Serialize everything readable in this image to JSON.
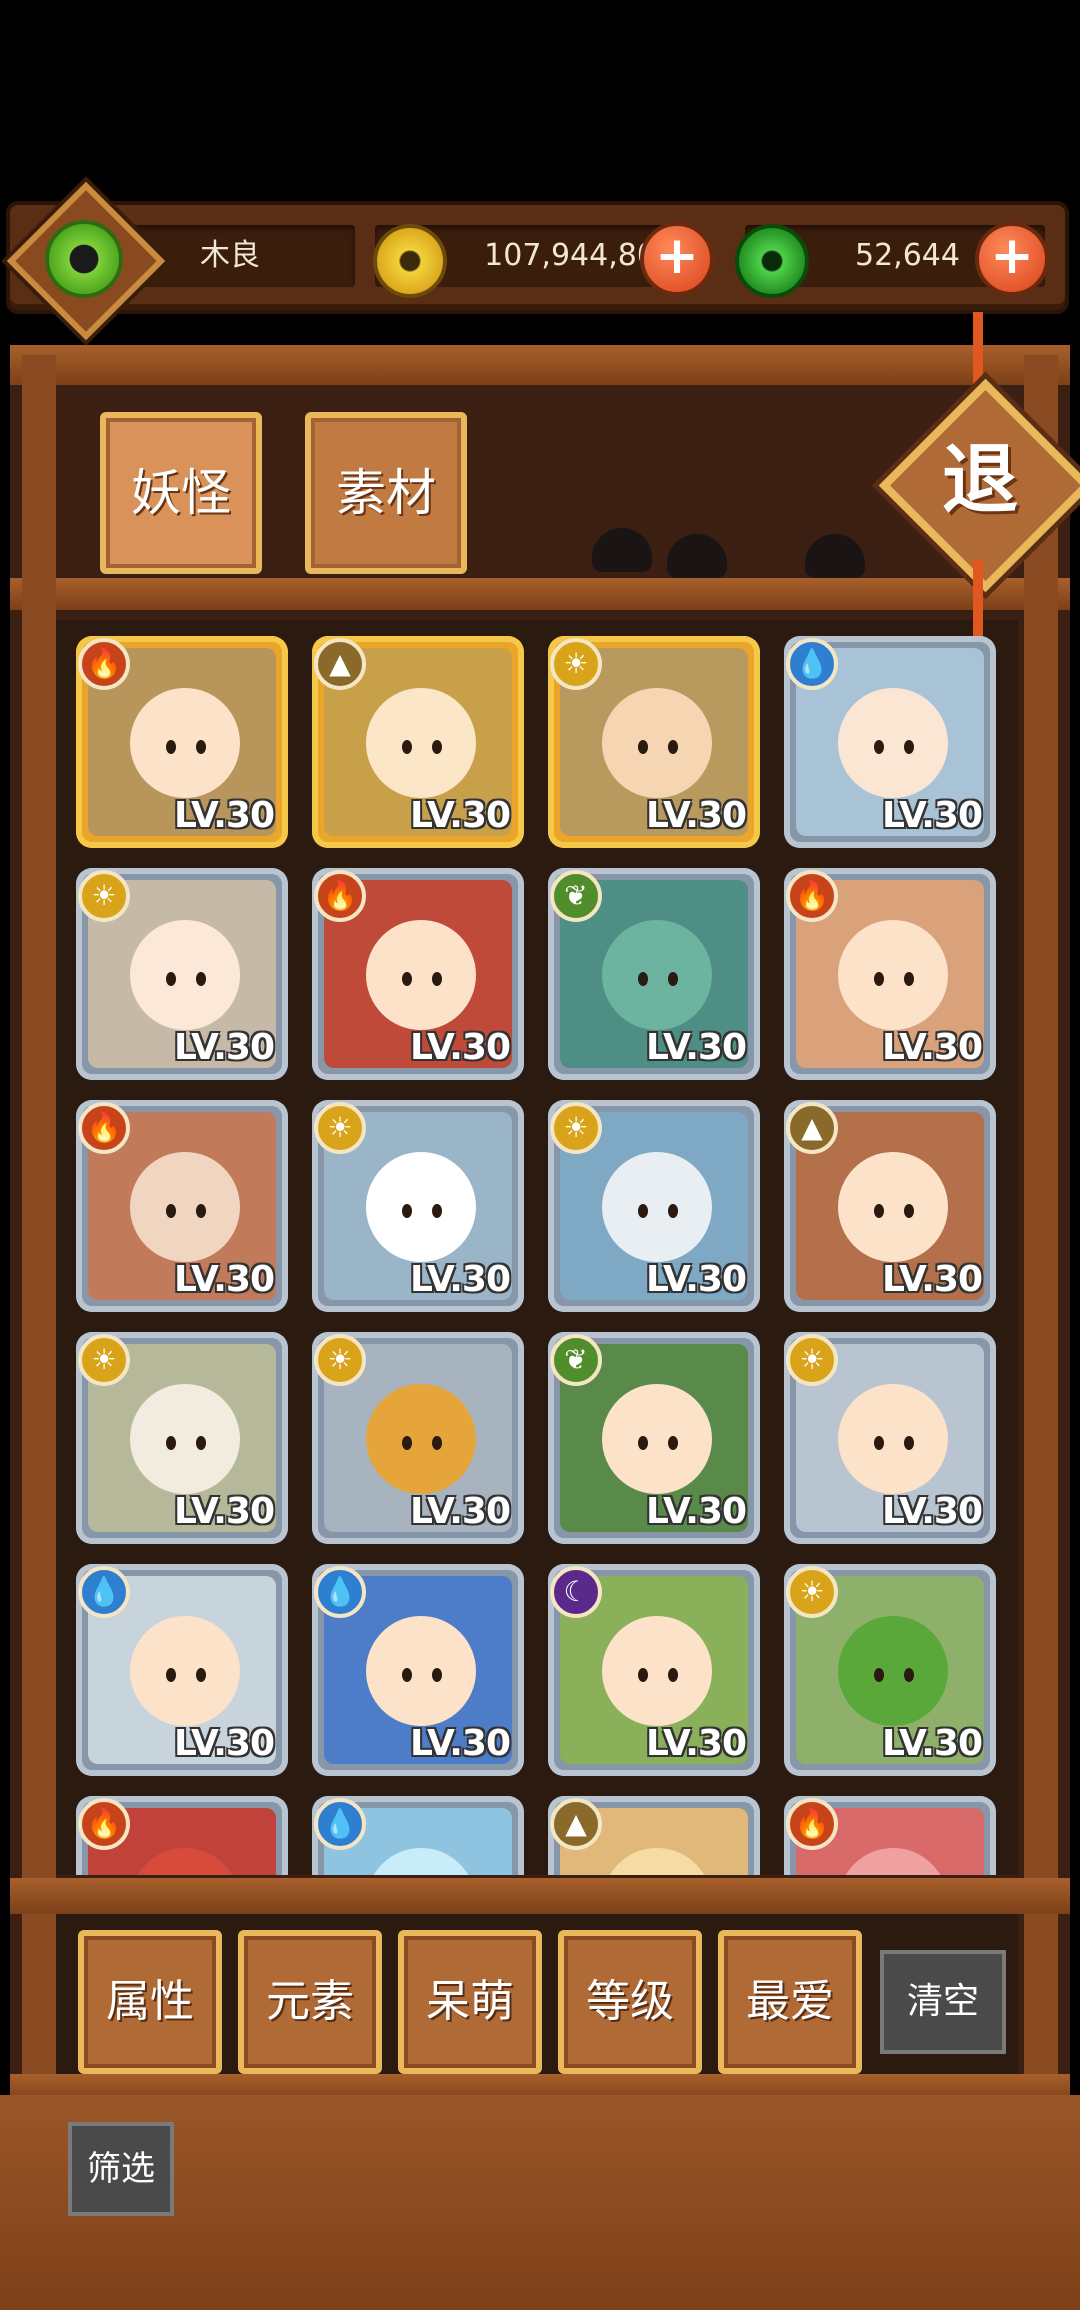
{
  "player": {
    "name": "木良"
  },
  "currency": {
    "gold": "107,944,803",
    "jade": "52,644",
    "colors": {
      "gold": "#e7c31b",
      "jade": "#2fc23a",
      "plus": "#e0521e"
    }
  },
  "tabs": [
    {
      "label": "妖怪",
      "active": true
    },
    {
      "label": "素材",
      "active": false
    }
  ],
  "exit_label": "退",
  "cards": [
    {
      "level": "LV.30",
      "element": "fire",
      "frame": "gold",
      "bg": "#b8955a",
      "face": "#fbe2c8"
    },
    {
      "level": "LV.30",
      "element": "earth",
      "frame": "gold",
      "bg": "#c9a04a",
      "face": "#fbe6c8"
    },
    {
      "level": "LV.30",
      "element": "light",
      "frame": "gold",
      "bg": "#b89a5e",
      "face": "#f6d6b2"
    },
    {
      "level": "LV.30",
      "element": "water",
      "frame": "grey",
      "bg": "#a9c3d6",
      "face": "#fbe6d4"
    },
    {
      "level": "LV.30",
      "element": "light",
      "frame": "grey",
      "bg": "#c7b9a8",
      "face": "#fbe8d8"
    },
    {
      "level": "LV.30",
      "element": "fire",
      "frame": "grey",
      "bg": "#c04a3a",
      "face": "#fbe2c8"
    },
    {
      "level": "LV.30",
      "element": "wood",
      "frame": "grey",
      "bg": "#4f8e84",
      "face": "#6cb3a0"
    },
    {
      "level": "LV.30",
      "element": "fire",
      "frame": "grey",
      "bg": "#d9a27a",
      "face": "#fbe2c8"
    },
    {
      "level": "LV.30",
      "element": "fire",
      "frame": "grey",
      "bg": "#c27b5a",
      "face": "#f0d6c0"
    },
    {
      "level": "LV.30",
      "element": "light",
      "frame": "grey",
      "bg": "#9ab4c8",
      "face": "#ffffff"
    },
    {
      "level": "LV.30",
      "element": "light",
      "frame": "grey",
      "bg": "#7fa8c4",
      "face": "#e8eef2"
    },
    {
      "level": "LV.30",
      "element": "earth",
      "frame": "grey",
      "bg": "#b4704a",
      "face": "#fbe2c8"
    },
    {
      "level": "LV.30",
      "element": "light",
      "frame": "grey",
      "bg": "#b6b89a",
      "face": "#f2ebe0"
    },
    {
      "level": "LV.30",
      "element": "light",
      "frame": "grey",
      "bg": "#a7b3bf",
      "face": "#e6a53a"
    },
    {
      "level": "LV.30",
      "element": "wood",
      "frame": "grey",
      "bg": "#5a8a4a",
      "face": "#fbe2c8"
    },
    {
      "level": "LV.30",
      "element": "light",
      "frame": "grey",
      "bg": "#b8c4d0",
      "face": "#fbe2c8"
    },
    {
      "level": "LV.30",
      "element": "water",
      "frame": "grey",
      "bg": "#c8d4dc",
      "face": "#fbe2c8"
    },
    {
      "level": "LV.30",
      "element": "water",
      "frame": "grey",
      "bg": "#4d7cc8",
      "face": "#fbe2c8"
    },
    {
      "level": "LV.30",
      "element": "dark",
      "frame": "grey",
      "bg": "#8ab05a",
      "face": "#fbe2c8"
    },
    {
      "level": "LV.30",
      "element": "light",
      "frame": "grey",
      "bg": "#8fb06a",
      "face": "#5aa83a"
    },
    {
      "level": "",
      "element": "fire",
      "frame": "grey",
      "bg": "#c0423a",
      "face": "#d84a3a"
    },
    {
      "level": "",
      "element": "water",
      "frame": "grey",
      "bg": "#8fc4e0",
      "face": "#c8ecf8"
    },
    {
      "level": "",
      "element": "earth",
      "frame": "grey",
      "bg": "#e0b87a",
      "face": "#f4dca4"
    },
    {
      "level": "",
      "element": "fire",
      "frame": "grey",
      "bg": "#d86a6a",
      "face": "#f0a0a0"
    }
  ],
  "element_icons": {
    "fire": {
      "glyph": "🔥",
      "color": "#c7431a"
    },
    "earth": {
      "glyph": "▲",
      "color": "#8a6a2a"
    },
    "light": {
      "glyph": "☀",
      "color": "#d9a41a"
    },
    "water": {
      "glyph": "💧",
      "color": "#2f7fd0"
    },
    "wood": {
      "glyph": "❦",
      "color": "#4f8e2a"
    },
    "dark": {
      "glyph": "☾",
      "color": "#5a2a8a"
    }
  },
  "filters": [
    {
      "label": "属性"
    },
    {
      "label": "元素"
    },
    {
      "label": "呆萌"
    },
    {
      "label": "等级"
    },
    {
      "label": "最爱"
    }
  ],
  "clear_label": "清空",
  "sift_label": "筛选"
}
